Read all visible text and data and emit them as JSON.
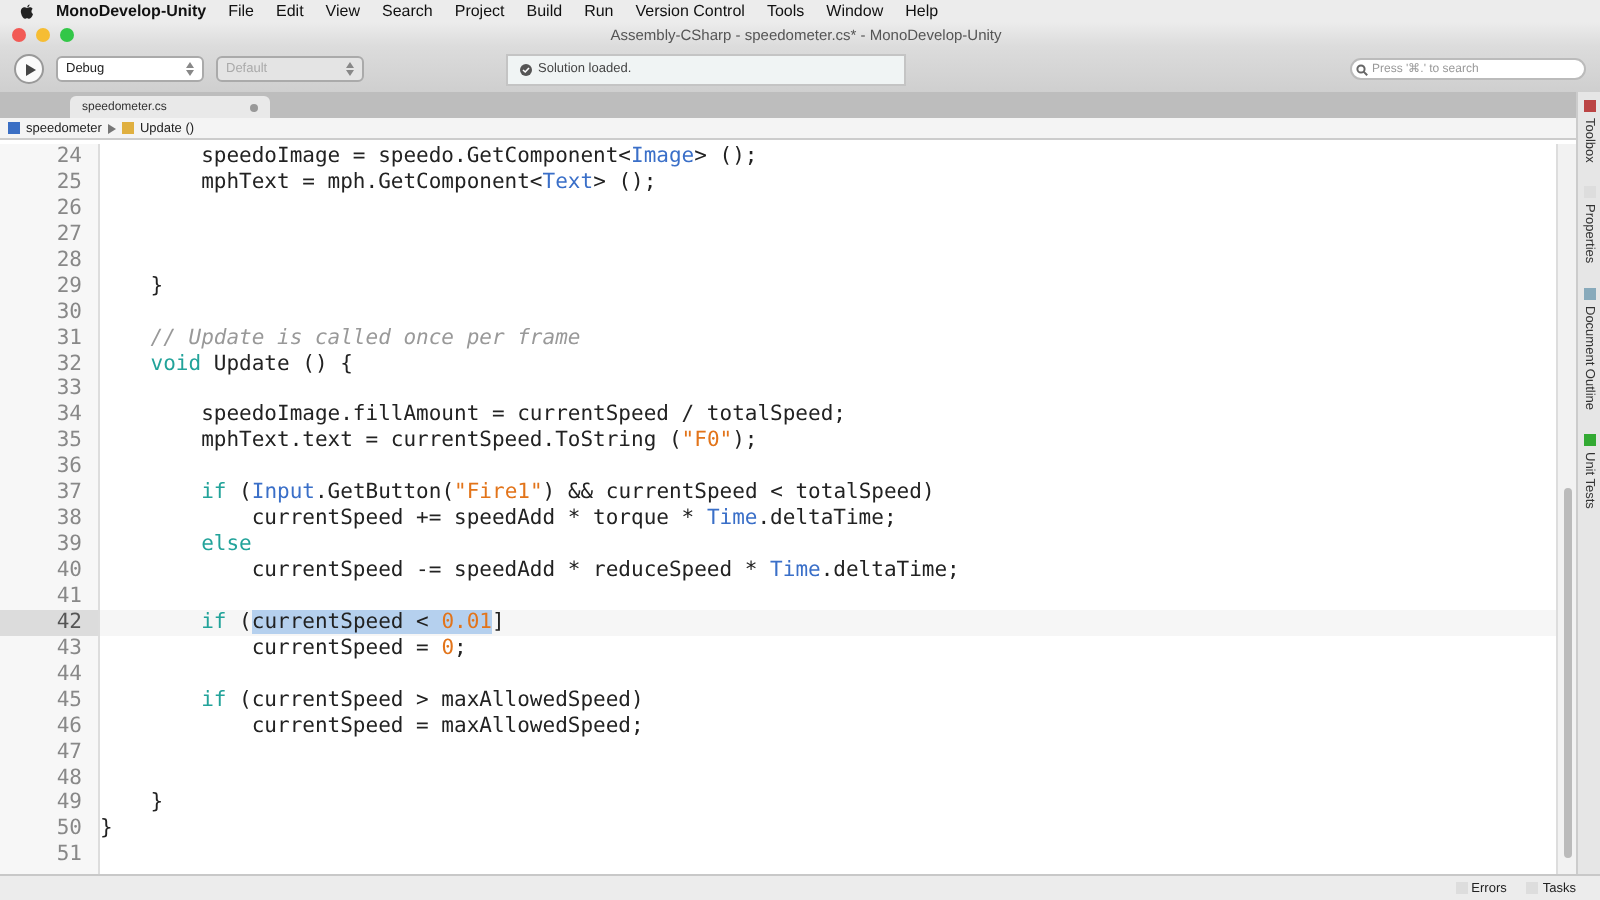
{
  "menubar": {
    "app": "MonoDevelop-Unity",
    "items": [
      "File",
      "Edit",
      "View",
      "Search",
      "Project",
      "Build",
      "Run",
      "Version Control",
      "Tools",
      "Window",
      "Help"
    ]
  },
  "window": {
    "title": "Assembly-CSharp - speedometer.cs* - MonoDevelop-Unity"
  },
  "toolbar": {
    "configuration": "Debug",
    "platform": "Default",
    "status": "Solution loaded.",
    "search": {
      "placeholder": "Press '⌘.' to search"
    }
  },
  "tabs": [
    {
      "label": "speedometer.cs",
      "selected": true
    }
  ],
  "breadcrumb": {
    "items": [
      "speedometer",
      "Update ()"
    ]
  },
  "side_tabs": [
    "Toolbox",
    "Properties",
    "Document Outline",
    "Unit Tests"
  ],
  "editor": {
    "lines": [
      {
        "number": "24",
        "current": false,
        "segments": [
          {
            "kind": "plain",
            "text": "        speedoImage = speedo.GetComponent<"
          },
          {
            "kind": "type",
            "text": "Image"
          },
          {
            "kind": "plain",
            "text": "> ();"
          }
        ]
      },
      {
        "number": "25",
        "current": false,
        "segments": [
          {
            "kind": "plain",
            "text": "        mphText = mph.GetComponent<"
          },
          {
            "kind": "type",
            "text": "Text"
          },
          {
            "kind": "plain",
            "text": "> ();"
          }
        ]
      },
      {
        "number": "26",
        "current": false
      },
      {
        "number": "27",
        "current": false
      },
      {
        "number": "28",
        "current": false
      },
      {
        "number": "29",
        "current": false,
        "segments": [
          {
            "kind": "plain",
            "text": "    }"
          }
        ]
      },
      {
        "number": "30",
        "current": false
      },
      {
        "number": "31",
        "current": false,
        "segments": [
          {
            "kind": "comment",
            "text": "    // Update is called once per frame"
          }
        ]
      },
      {
        "number": "32",
        "current": false,
        "segments": [
          {
            "kind": "keyword",
            "text": "    void"
          },
          {
            "kind": "plain",
            "text": " Update () {"
          }
        ]
      },
      {
        "number": "33",
        "current": false
      },
      {
        "number": "34",
        "current": false,
        "segments": [
          {
            "kind": "plain",
            "text": "        speedoImage.fillAmount = currentSpeed / totalSpeed;"
          }
        ]
      },
      {
        "number": "35",
        "current": false,
        "segments": [
          {
            "kind": "plain",
            "text": "        mphText.text = currentSpeed.ToString ("
          },
          {
            "kind": "string",
            "text": "\"F0\""
          },
          {
            "kind": "plain",
            "text": ");"
          }
        ]
      },
      {
        "number": "36",
        "current": false
      },
      {
        "number": "37",
        "current": false,
        "segments": [
          {
            "kind": "keyword",
            "text": "        if"
          },
          {
            "kind": "plain",
            "text": " ("
          },
          {
            "kind": "type",
            "text": "Input"
          },
          {
            "kind": "plain",
            "text": ".GetButton("
          },
          {
            "kind": "string",
            "text": "\"Fire1\""
          },
          {
            "kind": "plain",
            "text": ") && currentSpeed < totalSpeed)"
          }
        ]
      },
      {
        "number": "38",
        "current": false,
        "segments": [
          {
            "kind": "plain",
            "text": "            currentSpeed += speedAdd * torque * "
          },
          {
            "kind": "type",
            "text": "Time"
          },
          {
            "kind": "plain",
            "text": ".deltaTime;"
          }
        ]
      },
      {
        "number": "39",
        "current": false,
        "segments": [
          {
            "kind": "keyword",
            "text": "        else"
          }
        ]
      },
      {
        "number": "40",
        "current": false,
        "segments": [
          {
            "kind": "plain",
            "text": "            currentSpeed -= speedAdd * reduceSpeed * "
          },
          {
            "kind": "type",
            "text": "Time"
          },
          {
            "kind": "plain",
            "text": ".deltaTime;"
          }
        ]
      },
      {
        "number": "41",
        "current": false
      },
      {
        "number": "42",
        "current": true,
        "segments": [
          {
            "kind": "keyword",
            "text": "        if"
          },
          {
            "kind": "plain",
            "text": " ("
          },
          {
            "kind": "plain",
            "text": "currentSpeed < ",
            "selected": true
          },
          {
            "kind": "number",
            "text": "0.01",
            "selected": true
          },
          {
            "kind": "plain",
            "text": "]"
          }
        ]
      },
      {
        "number": "43",
        "current": false,
        "segments": [
          {
            "kind": "plain",
            "text": "            currentSpeed = "
          },
          {
            "kind": "number",
            "text": "0"
          },
          {
            "kind": "plain",
            "text": ";"
          }
        ]
      },
      {
        "number": "44",
        "current": false
      },
      {
        "number": "45",
        "current": false,
        "segments": [
          {
            "kind": "keyword",
            "text": "        if"
          },
          {
            "kind": "plain",
            "text": " (currentSpeed > maxAllowedSpeed)"
          }
        ]
      },
      {
        "number": "46",
        "current": false,
        "segments": [
          {
            "kind": "plain",
            "text": "            currentSpeed = maxAllowedSpeed;"
          }
        ]
      },
      {
        "number": "47",
        "current": false
      },
      {
        "number": "48",
        "current": false
      },
      {
        "number": "49",
        "current": false,
        "segments": [
          {
            "kind": "plain",
            "text": "    }"
          }
        ]
      },
      {
        "number": "50",
        "current": false,
        "segments": [
          {
            "kind": "plain",
            "text": "}"
          }
        ]
      },
      {
        "number": "51",
        "current": false
      }
    ]
  },
  "status_bar": {
    "buttons": [
      "Errors",
      "Tasks"
    ]
  }
}
